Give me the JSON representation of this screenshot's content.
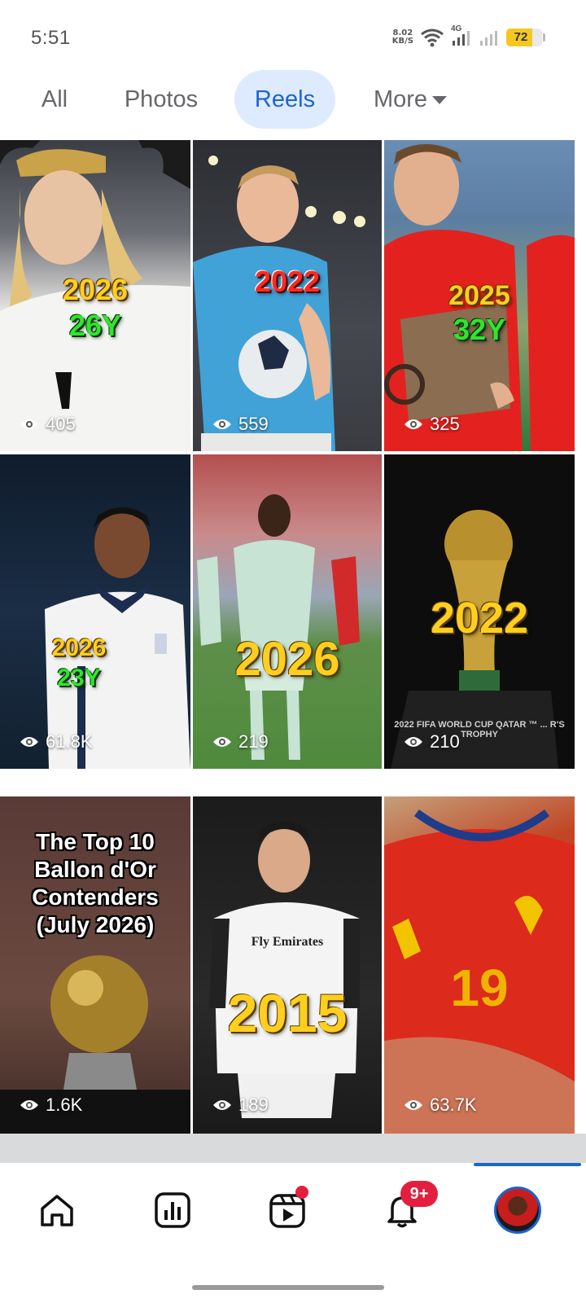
{
  "status_bar": {
    "time": "5:51",
    "net_speed_value": "8.02",
    "net_speed_unit": "KB/S",
    "network_type": "4G",
    "battery_level": "72",
    "battery_fraction": 0.72
  },
  "tabs": [
    {
      "label": "All",
      "active": false
    },
    {
      "label": "Photos",
      "active": false
    },
    {
      "label": "Reels",
      "active": true
    },
    {
      "label": "More",
      "active": false
    }
  ],
  "reels": [
    {
      "overlay": [
        "2026",
        "26Y"
      ],
      "views": "405"
    },
    {
      "overlay": [
        "2022"
      ],
      "views": "559"
    },
    {
      "overlay": [
        "2025",
        "32Y"
      ],
      "views": "325"
    },
    {
      "overlay": [
        "2026",
        "23Y"
      ],
      "views": "61.8K"
    },
    {
      "overlay": [
        "2026"
      ],
      "views": "219"
    },
    {
      "overlay": [
        "2022"
      ],
      "views": "210",
      "caption": "2022 FIFA WORLD CUP QATAR ™ ... R'S TROPHY"
    },
    {
      "overlay": [
        "The Top 10",
        "Ballon d'Or",
        "Contenders",
        "(July 2026)"
      ],
      "views": "1.6K"
    },
    {
      "overlay": [
        "2015"
      ],
      "views": "189",
      "caption": "Fly Emirates"
    },
    {
      "overlay": [],
      "views": "63.7K",
      "caption": "19"
    }
  ],
  "bottom_nav": {
    "notifications_badge": "9+"
  },
  "colors": {
    "accent": "#1b64d2",
    "tab_active_bg": "#deebff",
    "badge": "#e41e3f",
    "battery": "#f4c81f"
  }
}
